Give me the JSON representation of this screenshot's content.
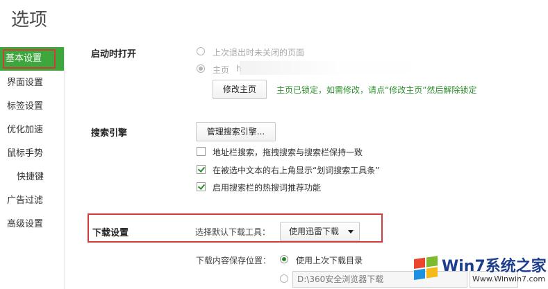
{
  "page": {
    "title": "选项"
  },
  "sidebar": {
    "items": [
      {
        "label": "基本设置",
        "active": true
      },
      {
        "label": "界面设置"
      },
      {
        "label": "标签设置"
      },
      {
        "label": "优化加速"
      },
      {
        "label": "鼠标手势"
      },
      {
        "label": "快捷键"
      },
      {
        "label": "广告过滤"
      },
      {
        "label": "高级设置"
      }
    ]
  },
  "startup": {
    "title": "启动时打开",
    "option_restore": "上次退出时未关闭的页面",
    "option_home": "主页",
    "homepage_url_prefix": "h",
    "modify_button": "修改主页",
    "locked_notice": "主页已锁定，如需修改，请点“修改主页”然后解除锁定"
  },
  "search": {
    "title": "搜索引擎",
    "manage_button": "管理搜索引擎...",
    "options": [
      {
        "label": "地址栏搜索，拖拽搜索与搜索栏保持一致",
        "checked": false
      },
      {
        "label": "在被选中文本的右上角显示“划词搜索工具条”",
        "checked": true
      },
      {
        "label": "启用搜索栏的热搜词推荐功能",
        "checked": true
      }
    ]
  },
  "download": {
    "title": "下载设置",
    "tool_label": "选择默认下载工具：",
    "tool_selected": "使用迅雷下载",
    "save_location_label": "下载内容保存位置：",
    "option_last_dir": "使用上次下载目录",
    "custom_path": "D:\\360安全浏览器下载"
  },
  "watermark": {
    "brand": "Win7系统之家",
    "url": "Www.Winwin7.com"
  },
  "colors": {
    "accent_green": "#3da63d",
    "highlight_red": "#d13b3b",
    "notice_green": "#2f8f2f"
  }
}
